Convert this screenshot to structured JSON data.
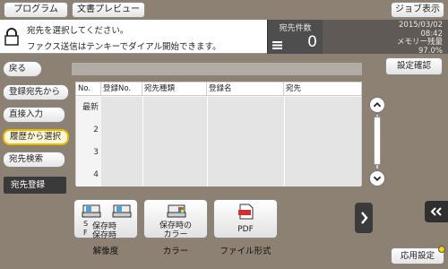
{
  "header": {
    "program_label": "プログラム",
    "preview_label": "文書プレビュー",
    "job_label": "ジョブ表示"
  },
  "message": {
    "line1": "宛先を選択してください。",
    "line2": "ファクス送信はテンキーでダイアル開始できます。"
  },
  "destination_count": {
    "label": "宛先件数",
    "value": "0"
  },
  "info": {
    "date": "2015/03/02",
    "time": "08:42",
    "memory_label": "メモリー残量",
    "memory_value": "97.0%"
  },
  "confirm_button": "設定確認",
  "sidebar": {
    "back": "戻る",
    "items": [
      {
        "label": "登録宛先から"
      },
      {
        "label": "直接入力"
      },
      {
        "label": "履歴から選択"
      },
      {
        "label": "宛先検索"
      }
    ],
    "register": "宛先登録"
  },
  "table": {
    "columns": [
      "No.",
      "登録No.",
      "宛先種類",
      "登録名",
      "宛先"
    ],
    "rows": [
      {
        "no": "最新"
      },
      {
        "no": "2"
      },
      {
        "no": "3"
      },
      {
        "no": "4"
      }
    ]
  },
  "functions": [
    {
      "line1": "保存時",
      "line2": "保存時",
      "prefix1": "S",
      "prefix2": "F",
      "label": "解像度"
    },
    {
      "line1": "保存時の",
      "line2": "カラー",
      "label": "カラー"
    },
    {
      "line1": "PDF",
      "label": "ファイル形式"
    }
  ],
  "application_button": "応用設定",
  "colors": {
    "background": "#8d8173",
    "active_highlight": "#e8b800",
    "info_bar": "#5f5a56"
  }
}
